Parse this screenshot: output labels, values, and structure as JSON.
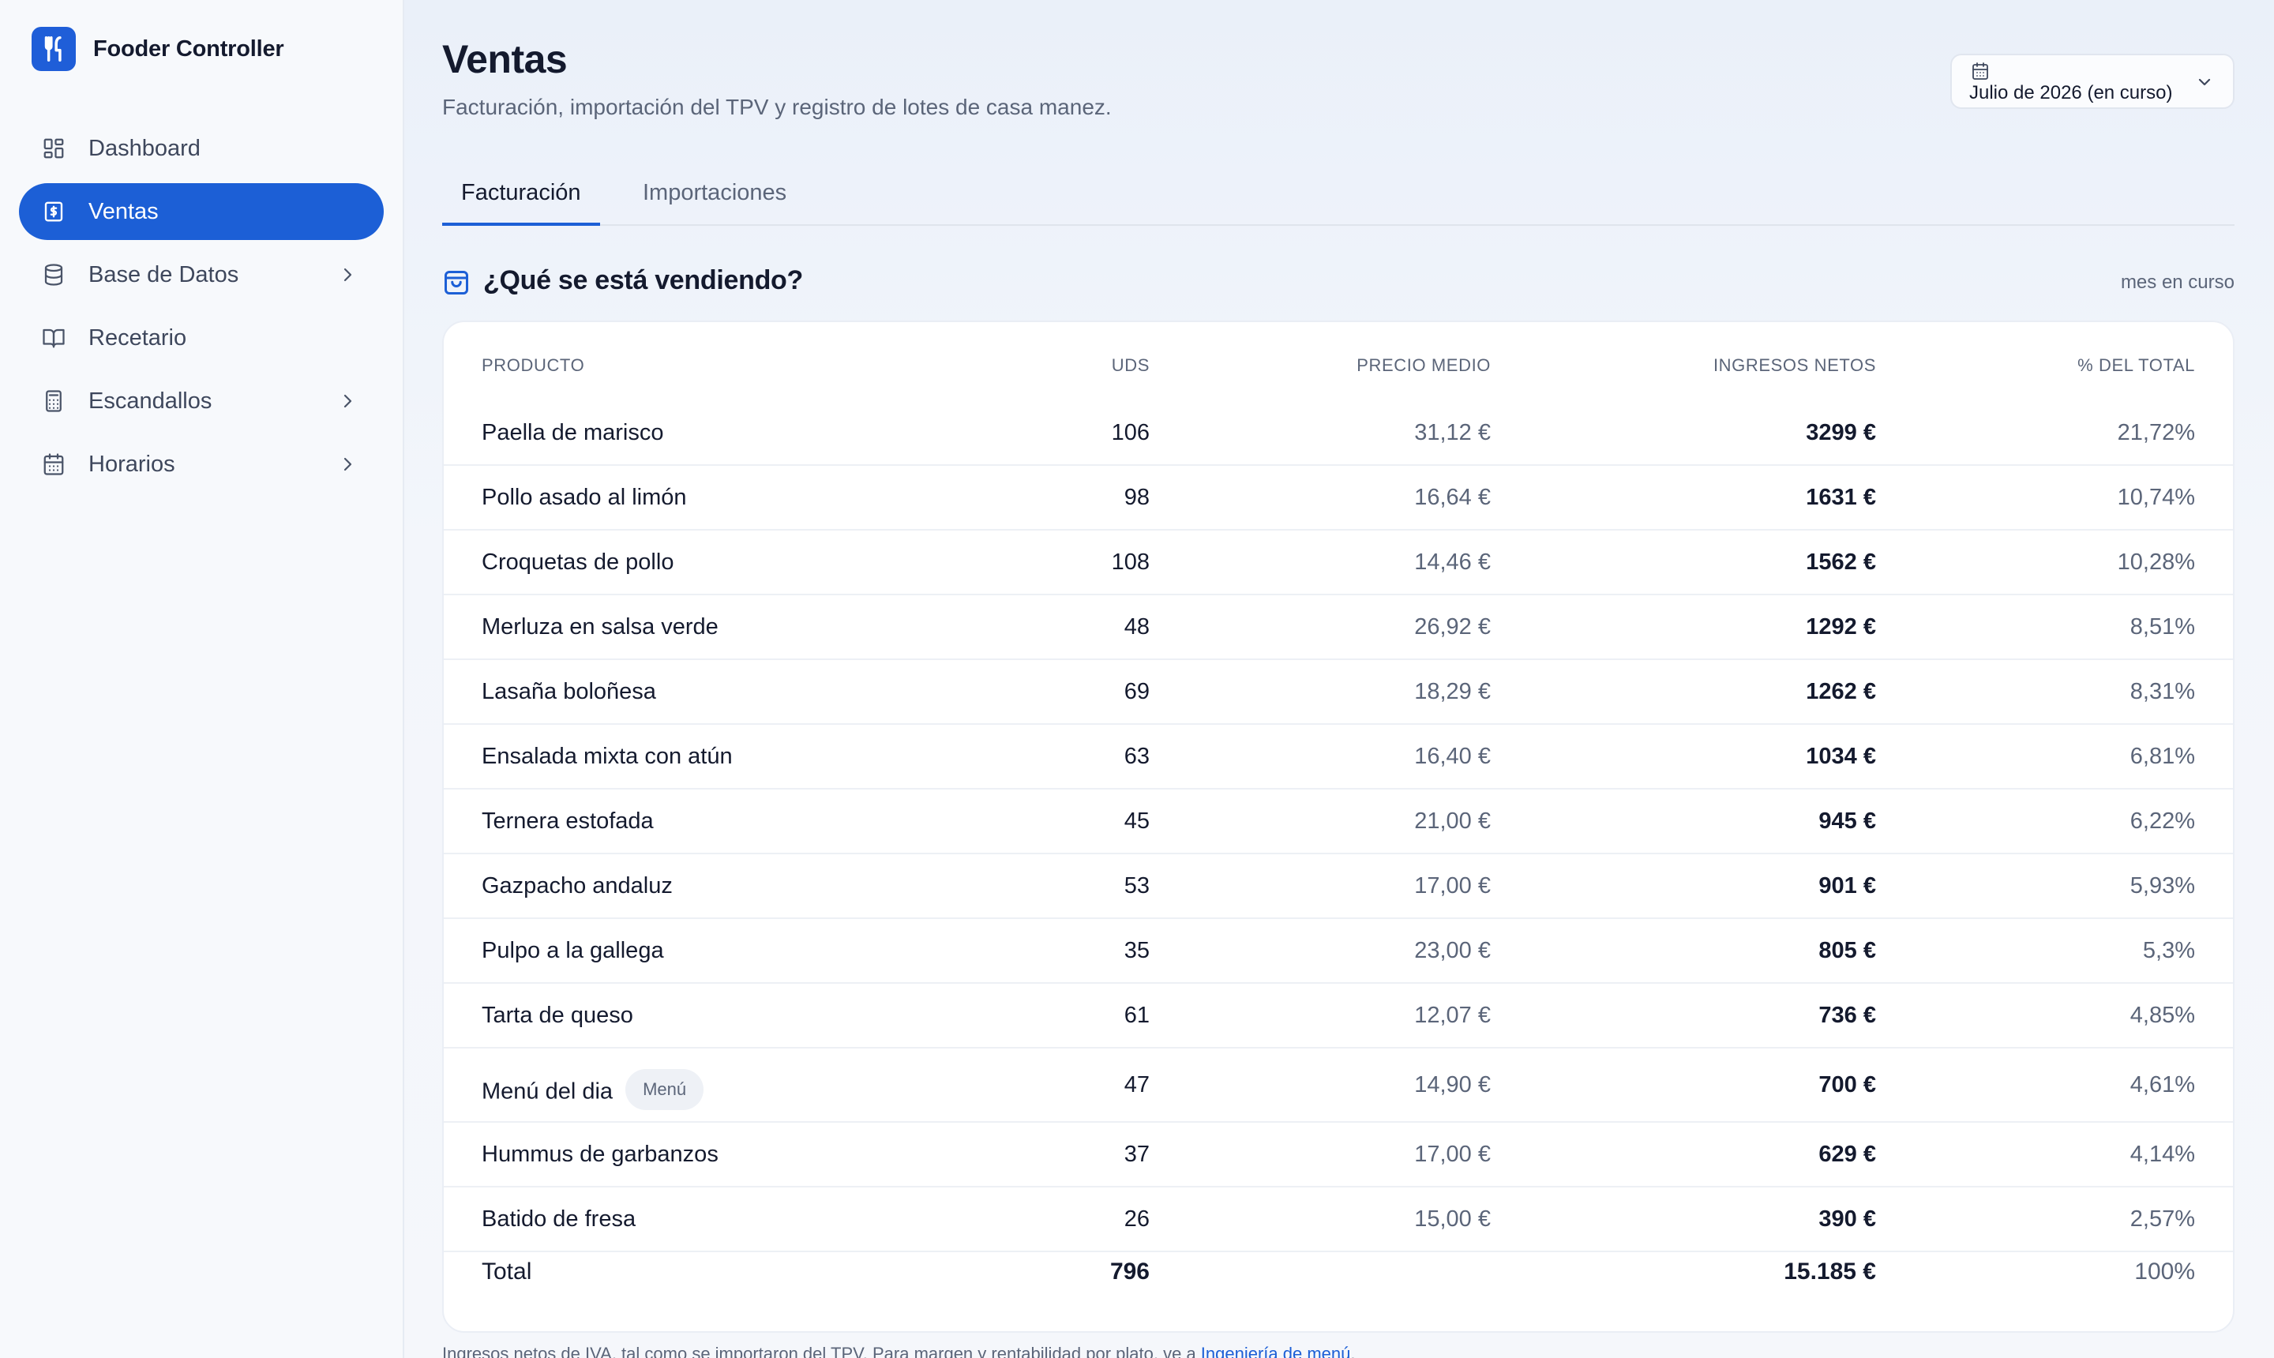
{
  "app": {
    "name": "Fooder Controller",
    "logo_icon": "utensils-icon",
    "accent_color": "#1c5fd6"
  },
  "sidebar": {
    "items": [
      {
        "label": "Dashboard",
        "icon": "dashboard-icon",
        "active": false,
        "has_chevron": false
      },
      {
        "label": "Ventas",
        "icon": "receipt-dollar-icon",
        "active": true,
        "has_chevron": false
      },
      {
        "label": "Base de Datos",
        "icon": "database-icon",
        "active": false,
        "has_chevron": true
      },
      {
        "label": "Recetario",
        "icon": "book-icon",
        "active": false,
        "has_chevron": false
      },
      {
        "label": "Escandallos",
        "icon": "calculator-icon",
        "active": false,
        "has_chevron": true
      },
      {
        "label": "Horarios",
        "icon": "calendar-icon",
        "active": false,
        "has_chevron": true
      }
    ]
  },
  "header": {
    "title": "Ventas",
    "subtitle": "Facturación, importación del TPV y registro de lotes de casa manez.",
    "period_select": {
      "value": "Julio de 2026 (en curso)",
      "icon": "calendar-icon"
    }
  },
  "tabs": [
    {
      "label": "Facturación",
      "active": true
    },
    {
      "label": "Importaciones",
      "active": false
    }
  ],
  "section": {
    "title": "¿Qué se está vendiendo?",
    "note": "mes en curso",
    "icon": "shopping-bag-icon"
  },
  "table": {
    "columns": [
      "PRODUCTO",
      "UDS",
      "PRECIO MEDIO",
      "INGRESOS NETOS",
      "% DEL TOTAL"
    ],
    "rows": [
      {
        "producto": "Paella de marisco",
        "uds": "106",
        "precio": "31,12 €",
        "neto": "3299 €",
        "pct": "21,72%"
      },
      {
        "producto": "Pollo asado al limón",
        "uds": "98",
        "precio": "16,64 €",
        "neto": "1631 €",
        "pct": "10,74%"
      },
      {
        "producto": "Croquetas de pollo",
        "uds": "108",
        "precio": "14,46 €",
        "neto": "1562 €",
        "pct": "10,28%"
      },
      {
        "producto": "Merluza en salsa verde",
        "uds": "48",
        "precio": "26,92 €",
        "neto": "1292 €",
        "pct": "8,51%"
      },
      {
        "producto": "Lasaña boloñesa",
        "uds": "69",
        "precio": "18,29 €",
        "neto": "1262 €",
        "pct": "8,31%"
      },
      {
        "producto": "Ensalada mixta con atún",
        "uds": "63",
        "precio": "16,40 €",
        "neto": "1034 €",
        "pct": "6,81%"
      },
      {
        "producto": "Ternera estofada",
        "uds": "45",
        "precio": "21,00 €",
        "neto": "945 €",
        "pct": "6,22%"
      },
      {
        "producto": "Gazpacho andaluz",
        "uds": "53",
        "precio": "17,00 €",
        "neto": "901 €",
        "pct": "5,93%"
      },
      {
        "producto": "Pulpo a la gallega",
        "uds": "35",
        "precio": "23,00 €",
        "neto": "805 €",
        "pct": "5,3%"
      },
      {
        "producto": "Tarta de queso",
        "uds": "61",
        "precio": "12,07 €",
        "neto": "736 €",
        "pct": "4,85%"
      },
      {
        "producto": "Menú del dia",
        "badge": "Menú",
        "uds": "47",
        "precio": "14,90 €",
        "neto": "700 €",
        "pct": "4,61%"
      },
      {
        "producto": "Hummus de garbanzos",
        "uds": "37",
        "precio": "17,00 €",
        "neto": "629 €",
        "pct": "4,14%"
      },
      {
        "producto": "Batido de fresa",
        "uds": "26",
        "precio": "15,00 €",
        "neto": "390 €",
        "pct": "2,57%"
      }
    ],
    "total": {
      "label": "Total",
      "uds": "796",
      "neto": "15.185 €",
      "pct": "100%"
    }
  },
  "footnote": {
    "text": "Ingresos netos de IVA, tal como se importaron del TPV. Para margen y rentabilidad por plato, ve a ",
    "link": "Ingeniería de menú",
    "suffix": "."
  }
}
